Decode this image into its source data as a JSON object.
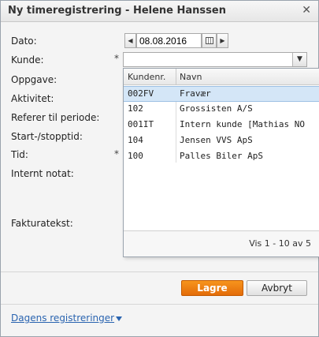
{
  "dialog": {
    "title": "Ny timeregistrering - Helene Hanssen",
    "close_glyph": "✕"
  },
  "form": {
    "labels": {
      "dato": "Dato:",
      "kunde": "Kunde:",
      "oppgave": "Oppgave:",
      "aktivitet": "Aktivitet:",
      "referer": "Referer til periode:",
      "startstopp": "Start-/stopptid:",
      "tid": "Tid:",
      "internt_notat": "Internt notat:",
      "fakturatekst": "Fakturatekst:"
    },
    "required_mark": "*",
    "date_value": "08.08.2016",
    "prev_glyph": "◀",
    "next_glyph": "▶",
    "combo_arrow_glyph": "▼",
    "kunde_value": ""
  },
  "customer_grid": {
    "columns": [
      "Kundenr.",
      "Navn"
    ],
    "rows": [
      {
        "nr": "002FV",
        "navn": "Fravær",
        "selected": true
      },
      {
        "nr": "102",
        "navn": "Grossisten A/S",
        "selected": false
      },
      {
        "nr": "001IT",
        "navn": "Intern kunde [Mathias NO...",
        "selected": false
      },
      {
        "nr": "104",
        "navn": "Jensen VVS ApS",
        "selected": false
      },
      {
        "nr": "100",
        "navn": "Palles Biler ApS",
        "selected": false
      }
    ],
    "pager": "Vis 1 - 10 av 5"
  },
  "buttons": {
    "save": "Lagre",
    "cancel": "Avbryt"
  },
  "footer": {
    "todays_link": "Dagens registreringer"
  },
  "icons": {
    "calendar": "calendar-icon",
    "close": "close-icon",
    "caret": "caret-down-icon"
  },
  "colors": {
    "save_button": "#e8760f",
    "selected_row": "#d4e6f7",
    "link": "#2a64b0"
  }
}
